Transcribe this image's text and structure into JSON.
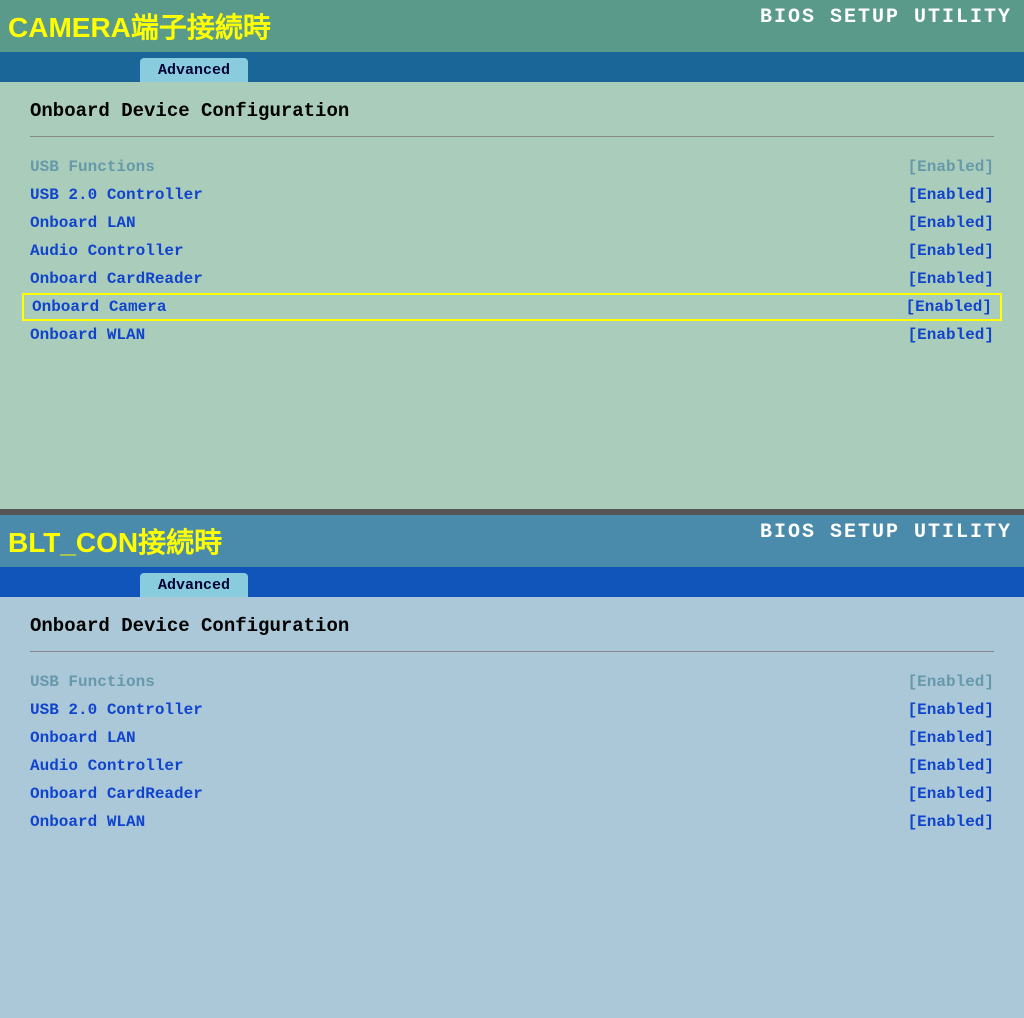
{
  "top_panel": {
    "annotation": "CAMERA端子接続時",
    "bios_label": "BIOS SETUP UTILITY",
    "tab": "Advanced",
    "section_title": "Onboard Device Configuration",
    "rows": [
      {
        "name": "USB Functions",
        "value": "[Enabled]",
        "highlighted": false,
        "faded": true
      },
      {
        "name": "USB 2.0 Controller",
        "value": "[Enabled]",
        "highlighted": false,
        "faded": false
      },
      {
        "name": "Onboard LAN",
        "value": "[Enabled]",
        "highlighted": false,
        "faded": false
      },
      {
        "name": "Audio Controller",
        "value": "[Enabled]",
        "highlighted": false,
        "faded": false
      },
      {
        "name": "Onboard CardReader",
        "value": "[Enabled]",
        "highlighted": false,
        "faded": false
      },
      {
        "name": "Onboard Camera",
        "value": "[Enabled]",
        "highlighted": true,
        "faded": false
      },
      {
        "name": "Onboard WLAN",
        "value": "[Enabled]",
        "highlighted": false,
        "faded": false
      }
    ]
  },
  "bottom_panel": {
    "annotation": "BLT_CON接続時",
    "bios_label": "BIOS SETUP UTILITY",
    "tab": "Advanced",
    "section_title": "Onboard Device Configuration",
    "rows": [
      {
        "name": "USB Functions",
        "value": "[Enabled]",
        "highlighted": false,
        "faded": true
      },
      {
        "name": "USB 2.0 Controller",
        "value": "[Enabled]",
        "highlighted": false,
        "faded": false
      },
      {
        "name": "Onboard LAN",
        "value": "[Enabled]",
        "highlighted": false,
        "faded": false
      },
      {
        "name": "Audio Controller",
        "value": "[Enabled]",
        "highlighted": false,
        "faded": false
      },
      {
        "name": "Onboard CardReader",
        "value": "[Enabled]",
        "highlighted": false,
        "faded": false
      },
      {
        "name": "Onboard WLAN",
        "value": "[Enabled]",
        "highlighted": false,
        "faded": false
      }
    ]
  }
}
